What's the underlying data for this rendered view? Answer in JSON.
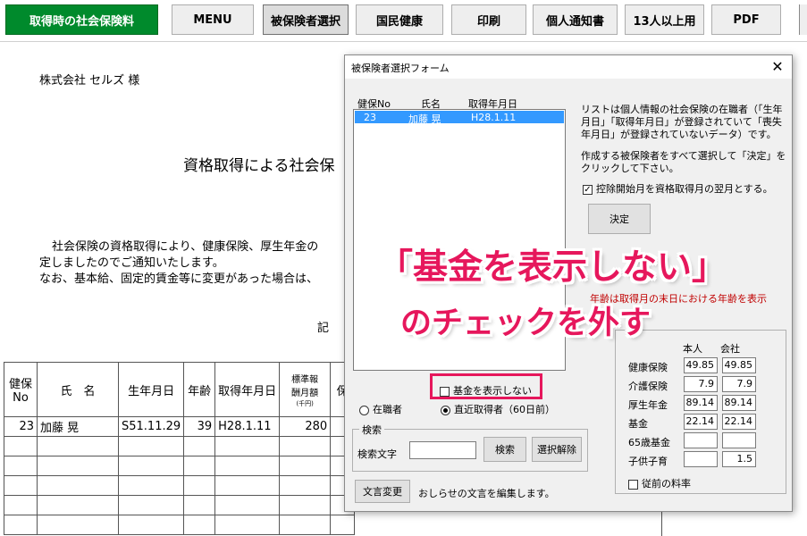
{
  "toolbar": {
    "title_button": "取得時の社会保険料",
    "menu": "MENU",
    "select_insured": "被保険者選択",
    "national_health": "国民健康",
    "print": "印刷",
    "personal_notice": "個人通知書",
    "over13": "13人以上用",
    "pdf": "PDF"
  },
  "document": {
    "company": "株式会社 セルズ 様",
    "heading": "資格取得による社会保",
    "para_line1": "社会保険の資格取得により、健康保険、厚生年金の",
    "para_line2": "定しましたのでご通知いたします。",
    "para_line3": "なお、基本給、固定的賃金等に変更があった場合は、",
    "ki": "記",
    "table": {
      "headers": {
        "no_line1": "健保",
        "no_line2": "No",
        "name": "氏　名",
        "birth": "生年月日",
        "age": "年齢",
        "acquired": "取得年月日",
        "salary_line1": "標準報",
        "salary_line2": "酬月額",
        "salary_unit": "(千円)",
        "ho": "保"
      },
      "row": {
        "no": "23",
        "name": "加藤 晃",
        "birth": "S51.11.29",
        "age": "39",
        "acquired": "H28.1.11",
        "salary": "280"
      }
    }
  },
  "dialog": {
    "title": "被保険者選択フォーム",
    "close": "✕",
    "list_headers": {
      "no": "健保No",
      "name": "氏名",
      "date": "取得年月日"
    },
    "list_row": {
      "no": "23",
      "name": "加藤 晃",
      "date": "H28.1.11"
    },
    "info_line1": "リストは個人情報の社会保険の在職者（「生年",
    "info_line2": "月日」「取得年月日」が登録されていて「喪失",
    "info_line3": "年月日」が登録されていないデータ）です。",
    "info_line4": "作成する被保険者をすべて選択して「決定」を",
    "info_line5": "クリックして下さい。",
    "deduct_checkbox": "控除開始月を資格取得月の翌月とする。",
    "decide_button": "決定",
    "age_note": "年齢は取得月の末日における年齢を表示",
    "hide_fund_checkbox": "基金を表示しない",
    "radio_employed": "在職者",
    "radio_recent": "直近取得者（60日前）",
    "search_group": "検索",
    "search_label": "検索文字",
    "search_button": "検索",
    "clear_button": "選択解除",
    "text_change_button": "文言変更",
    "text_change_note": "おしらせの文言を編集します。",
    "rates": {
      "col_self": "本人",
      "col_company": "会社",
      "rows": [
        {
          "label": "健康保険",
          "self": "49.85",
          "company": "49.85"
        },
        {
          "label": "介護保険",
          "self": "7.9",
          "company": "7.9"
        },
        {
          "label": "厚生年金",
          "self": "89.14",
          "company": "89.14"
        },
        {
          "label": "基金",
          "self": "22.14",
          "company": "22.14"
        },
        {
          "label": "65歳基金",
          "self": "",
          "company": ""
        },
        {
          "label": "子供子育",
          "self": "",
          "company": "1.5"
        }
      ],
      "legacy_checkbox": "従前の料率"
    }
  },
  "annotation": {
    "line1": "「基金を表示しない」",
    "line2": "のチェックを外す"
  },
  "colors": {
    "accent_pink": "#e6175c",
    "green": "#008a2c",
    "selection": "#3399ff"
  }
}
